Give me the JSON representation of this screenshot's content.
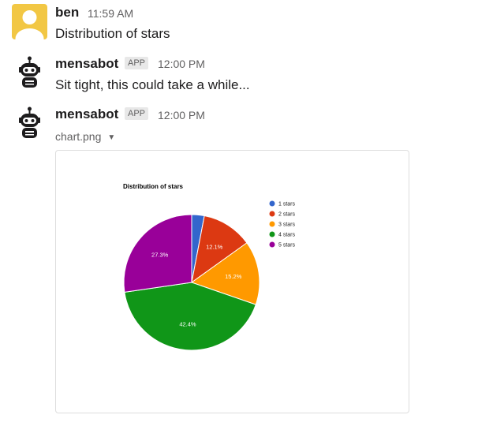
{
  "messages": [
    {
      "sender": "ben",
      "time": "11:59 AM",
      "text": "Distribution of stars",
      "avatar_icon": "default-user-avatar"
    },
    {
      "sender": "mensabot",
      "badge": "APP",
      "time": "12:00 PM",
      "text": "Sit tight, this could take a while...",
      "avatar_icon": "robot-avatar"
    },
    {
      "sender": "mensabot",
      "badge": "APP",
      "time": "12:00 PM",
      "file_name": "chart.png",
      "avatar_icon": "robot-avatar"
    }
  ],
  "colors": {
    "badge_bg": "#e8e8e8",
    "user_avatar_bg": "#f2c744"
  },
  "chart_data": {
    "type": "pie",
    "title": "Distribution of stars",
    "categories": [
      "1 stars",
      "2 stars",
      "3 stars",
      "4 stars",
      "5 stars"
    ],
    "values": [
      3.0,
      12.1,
      15.2,
      42.4,
      27.3
    ],
    "data_labels": [
      "",
      "12.1%",
      "15.2%",
      "42.4%",
      "27.3%"
    ],
    "colors": [
      "#3366cc",
      "#dc3912",
      "#ff9900",
      "#109618",
      "#990099"
    ],
    "legend_position": "right"
  }
}
